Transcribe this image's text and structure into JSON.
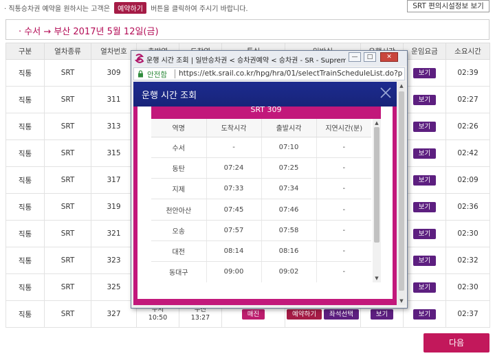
{
  "notice": {
    "text_before": "· 직통승차권 예약을 원하시는 고객은",
    "button_label": "예약하기",
    "text_after": "버튼을 클릭하여 주시기 바랍니다."
  },
  "facility_button": "SRT 편의시설정보 보기",
  "route_title": "· 수서 → 부산  2017년 5월 12일(금)",
  "table": {
    "headers": [
      "구분",
      "열차종류",
      "열차번호",
      "출발역",
      "도착역",
      "특실",
      "일반실",
      "유행시간",
      "운임요금",
      "소요시간"
    ],
    "view_label": "보기",
    "rows": [
      {
        "kind": "직통",
        "type": "SRT",
        "no": "309",
        "duration": "02:39"
      },
      {
        "kind": "직통",
        "type": "SRT",
        "no": "311",
        "duration": "02:27"
      },
      {
        "kind": "직통",
        "type": "SRT",
        "no": "313",
        "duration": "02:26"
      },
      {
        "kind": "직통",
        "type": "SRT",
        "no": "315",
        "duration": "02:42"
      },
      {
        "kind": "직통",
        "type": "SRT",
        "no": "317",
        "duration": "02:09"
      },
      {
        "kind": "직통",
        "type": "SRT",
        "no": "319",
        "duration": "02:36"
      },
      {
        "kind": "직통",
        "type": "SRT",
        "no": "321",
        "duration": "02:30"
      },
      {
        "kind": "직통",
        "type": "SRT",
        "no": "323",
        "duration": "02:32"
      },
      {
        "kind": "직통",
        "type": "SRT",
        "no": "325",
        "duration": "02:30"
      },
      {
        "kind": "직통",
        "type": "SRT",
        "no": "327",
        "duration": "02:37",
        "dep_station": "수서",
        "dep_time": "10:50",
        "arr_station": "부산",
        "arr_time": "13:27",
        "special": "매진",
        "reserve": "예약하기",
        "seat": "좌석선택",
        "schedule": "보기"
      }
    ]
  },
  "next_button": "다음",
  "popup": {
    "window_title": "운행 시간 조회 | 일반승차권 < 승차권예약 < 승차권 - SR - Supreme...",
    "controls": {
      "minimize": "—",
      "maximize": "□",
      "close": "✕"
    },
    "address": {
      "secure_label": "안전함",
      "url": "https://etk.srail.co.kr/hpg/hra/01/selectTrainScheduleList.do?page"
    },
    "header_title": "운행 시간 조회",
    "train_title": "SRT 309",
    "columns": [
      "역명",
      "도착시각",
      "출발시각",
      "지연시간(분)"
    ],
    "stops": [
      {
        "station": "수서",
        "arr": "-",
        "dep": "07:10",
        "delay": "-"
      },
      {
        "station": "동탄",
        "arr": "07:24",
        "dep": "07:25",
        "delay": "-"
      },
      {
        "station": "지제",
        "arr": "07:33",
        "dep": "07:34",
        "delay": "-"
      },
      {
        "station": "천안아산",
        "arr": "07:45",
        "dep": "07:46",
        "delay": "-"
      },
      {
        "station": "오송",
        "arr": "07:57",
        "dep": "07:58",
        "delay": "-"
      },
      {
        "station": "대전",
        "arr": "08:14",
        "dep": "08:16",
        "delay": "-"
      },
      {
        "station": "동대구",
        "arr": "09:00",
        "dep": "09:02",
        "delay": "-"
      }
    ]
  },
  "colors": {
    "brand_magenta": "#c2187b",
    "brand_purple": "#5d1f80",
    "header_navy": "#1c2b8f"
  }
}
